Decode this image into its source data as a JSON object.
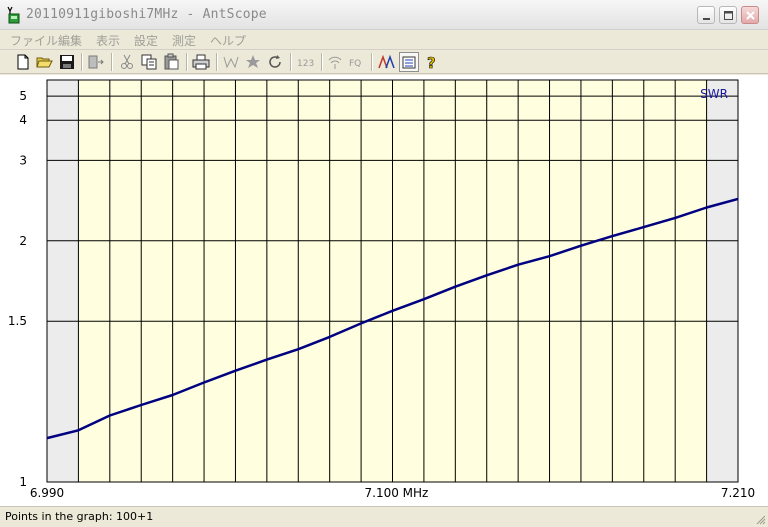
{
  "window": {
    "title": "20110911giboshi7MHz - AntScope"
  },
  "menu": {
    "items": [
      "ファイル",
      "編集",
      "表示",
      "設定",
      "測定",
      "ヘルプ"
    ]
  },
  "toolbar": {
    "icons": [
      "new-file-icon",
      "open-folder-icon",
      "save-icon",
      "export-icon",
      "cut-icon",
      "copy-icon",
      "paste-icon",
      "print-icon",
      "marker-icon",
      "star-icon",
      "refresh-icon",
      "number-icon",
      "wireless-icon",
      "frequency-icon",
      "multi-graph-icon",
      "list-icon",
      "help-icon"
    ],
    "number_label": "123",
    "frequency_label": "FQ"
  },
  "colors": {
    "plot_bg": "#ffffe0",
    "margin_bg": "#ececec",
    "grid": "#000000",
    "curve": "#000080",
    "series_label": "#1a1aa0"
  },
  "status": {
    "text": "Points in the graph: 100+1"
  },
  "chart_data": {
    "type": "line",
    "series": [
      {
        "name": "SWR",
        "x": [
          6.99,
          7.0,
          7.01,
          7.02,
          7.03,
          7.04,
          7.05,
          7.06,
          7.07,
          7.08,
          7.09,
          7.1,
          7.11,
          7.12,
          7.13,
          7.14,
          7.15,
          7.16,
          7.17,
          7.18,
          7.19,
          7.2,
          7.21
        ],
        "y": [
          1.1,
          1.12,
          1.16,
          1.19,
          1.22,
          1.26,
          1.3,
          1.34,
          1.38,
          1.43,
          1.49,
          1.55,
          1.61,
          1.68,
          1.75,
          1.82,
          1.88,
          1.96,
          2.04,
          2.12,
          2.21,
          2.32,
          2.42
        ]
      }
    ],
    "x_ticks": [
      "6.990",
      "7.100 MHz",
      "7.210"
    ],
    "y_ticks": [
      "1",
      "1.5",
      "2",
      "3",
      "4",
      "5"
    ],
    "xlim": [
      6.99,
      7.21
    ],
    "ylim": [
      1,
      6
    ],
    "y_scale": "reciprocal",
    "grid": true,
    "x_grid_step": 0.01,
    "band_shaded": [
      7.0,
      7.2
    ]
  }
}
